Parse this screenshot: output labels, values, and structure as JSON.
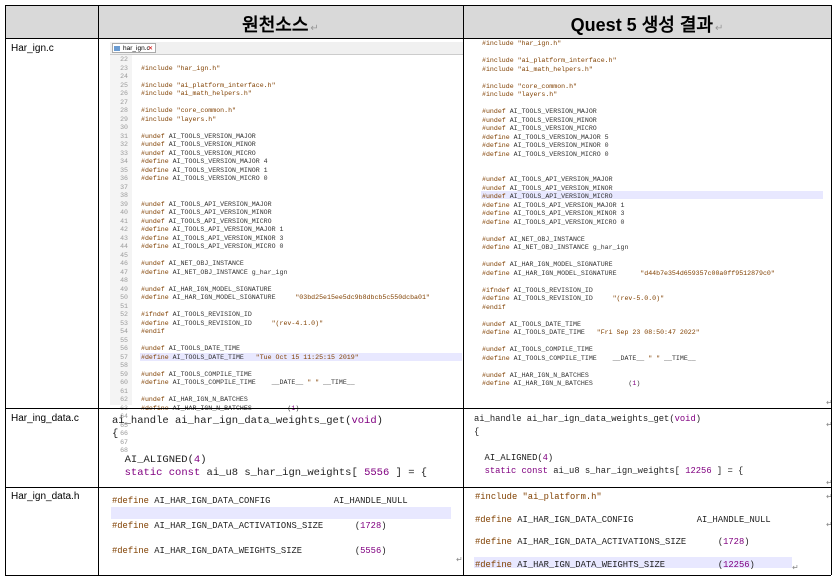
{
  "header": {
    "source_label": "원천소스",
    "result_label": "Quest 5 생성 결과"
  },
  "rows": {
    "r1": "Har_ign.c",
    "r2": "Har_ing_data.c",
    "r3": "Har_ign_data.h"
  },
  "tab": {
    "filename": "har_ign.c"
  },
  "src1_lines": [
    "22",
    "23",
    "24",
    "25",
    "26",
    "27",
    "28",
    "29",
    "30",
    "31",
    "32",
    "33",
    "34",
    "35",
    "36",
    "37",
    "38",
    "39",
    "40",
    "41",
    "42",
    "43",
    "44",
    "45",
    "46",
    "47",
    "48",
    "49",
    "50",
    "51",
    "52",
    "53",
    "54",
    "55",
    "56",
    "57",
    "58",
    "59",
    "60",
    "61",
    "62",
    "63",
    "64",
    "65",
    "66",
    "67",
    "68"
  ],
  "src1": [
    "",
    "#include \"har_ign.h\"",
    "",
    "#include \"ai_platform_interface.h\"",
    "#include \"ai_math_helpers.h\"",
    "",
    "#include \"core_common.h\"",
    "#include \"layers.h\"",
    "",
    "#undef AI_TOOLS_VERSION_MAJOR",
    "#undef AI_TOOLS_VERSION_MINOR",
    "#undef AI_TOOLS_VERSION_MICRO",
    "#define AI_TOOLS_VERSION_MAJOR 4",
    "#define AI_TOOLS_VERSION_MINOR 1",
    "#define AI_TOOLS_VERSION_MICRO 0",
    "",
    "",
    "#undef AI_TOOLS_API_VERSION_MAJOR",
    "#undef AI_TOOLS_API_VERSION_MINOR",
    "#undef AI_TOOLS_API_VERSION_MICRO",
    "#define AI_TOOLS_API_VERSION_MAJOR 1",
    "#define AI_TOOLS_API_VERSION_MINOR 3",
    "#define AI_TOOLS_API_VERSION_MICRO 0",
    "",
    "#undef AI_NET_OBJ_INSTANCE",
    "#define AI_NET_OBJ_INSTANCE g_har_ign",
    "",
    "#undef AI_HAR_IGN_MODEL_SIGNATURE",
    "#define AI_HAR_IGN_MODEL_SIGNATURE     \"03bd25e15ee5dc9b8dbcb5c550dcba01\"",
    "",
    "#ifndef AI_TOOLS_REVISION_ID",
    "#define AI_TOOLS_REVISION_ID     \"(rev-4.1.0)\"",
    "#endif",
    "",
    "#undef AI_TOOLS_DATE_TIME",
    "#define AI_TOOLS_DATE_TIME   \"Tue Oct 15 11:25:15 2019\"",
    "",
    "#undef AI_TOOLS_COMPILE_TIME",
    "#define AI_TOOLS_COMPILE_TIME    __DATE__ \" \" __TIME__",
    "",
    "#undef AI_HAR_IGN_N_BATCHES",
    "#define AI_HAR_IGN_N_BATCHES         (1)"
  ],
  "res1": [
    "#include \"har_ign.h\"",
    "",
    "#include \"ai_platform_interface.h\"",
    "#include \"ai_math_helpers.h\"",
    "",
    "#include \"core_common.h\"",
    "#include \"layers.h\"",
    "",
    "#undef AI_TOOLS_VERSION_MAJOR",
    "#undef AI_TOOLS_VERSION_MINOR",
    "#undef AI_TOOLS_VERSION_MICRO",
    "#define AI_TOOLS_VERSION_MAJOR 5",
    "#define AI_TOOLS_VERSION_MINOR 0",
    "#define AI_TOOLS_VERSION_MICRO 0",
    "",
    "",
    "#undef AI_TOOLS_API_VERSION_MAJOR",
    "#undef AI_TOOLS_API_VERSION_MINOR",
    "#undef AI_TOOLS_API_VERSION_MICRO",
    "#define AI_TOOLS_API_VERSION_MAJOR 1",
    "#define AI_TOOLS_API_VERSION_MINOR 3",
    "#define AI_TOOLS_API_VERSION_MICRO 0",
    "",
    "#undef AI_NET_OBJ_INSTANCE",
    "#define AI_NET_OBJ_INSTANCE g_har_ign",
    "",
    "#undef AI_HAR_IGN_MODEL_SIGNATURE",
    "#define AI_HAR_IGN_MODEL_SIGNATURE      \"d44b7e354d659357c00a0ff9512879c0\"",
    "",
    "#ifndef AI_TOOLS_REVISION_ID",
    "#define AI_TOOLS_REVISION_ID     \"(rev-5.0.0)\"",
    "#endif",
    "",
    "#undef AI_TOOLS_DATE_TIME",
    "#define AI_TOOLS_DATE_TIME   \"Fri Sep 23 08:50:47 2022\"",
    "",
    "#undef AI_TOOLS_COMPILE_TIME",
    "#define AI_TOOLS_COMPILE_TIME    __DATE__ \" \" __TIME__",
    "",
    "#undef AI_HAR_IGN_N_BATCHES",
    "#define AI_HAR_IGN_N_BATCHES         (1)"
  ],
  "src2": [
    "ai_handle ai_har_ign_data_weights_get(void)",
    "{",
    "",
    "  AI_ALIGNED(4)",
    "  static const ai_u8 s_har_ign_weights[ 5556 ] = {"
  ],
  "res2": [
    "ai_handle ai_har_ign_data_weights_get(void)",
    "{",
    "",
    "  AI_ALIGNED(4)",
    "  static const ai_u8 s_har_ign_weights[ 12256 ] = {"
  ],
  "src3": [
    "#define AI_HAR_IGN_DATA_CONFIG            AI_HANDLE_NULL",
    "",
    "#define AI_HAR_IGN_DATA_ACTIVATIONS_SIZE      (1728)",
    "",
    "#define AI_HAR_IGN_DATA_WEIGHTS_SIZE          (5556)"
  ],
  "res3": [
    "#include \"ai_platform.h\"",
    "",
    "#define AI_HAR_IGN_DATA_CONFIG            AI_HANDLE_NULL",
    "",
    "#define AI_HAR_IGN_DATA_ACTIVATIONS_SIZE      (1728)",
    "",
    "#define AI_HAR_IGN_DATA_WEIGHTS_SIZE          (12256)"
  ]
}
